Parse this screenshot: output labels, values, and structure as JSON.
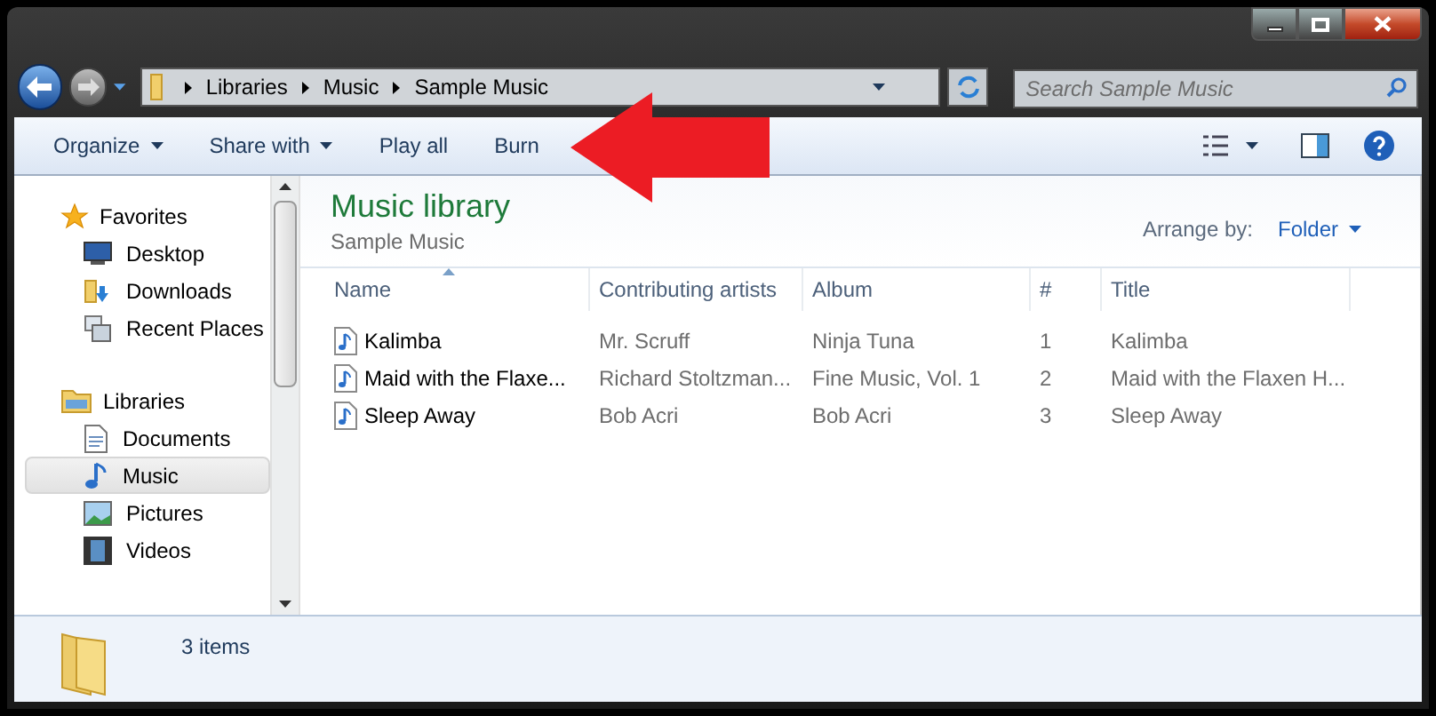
{
  "address": {
    "crumbs": [
      "Libraries",
      "Music",
      "Sample Music"
    ]
  },
  "search": {
    "placeholder": "Search Sample Music"
  },
  "toolbar": [
    {
      "label": "Organize",
      "menu": true
    },
    {
      "label": "Share with",
      "menu": true
    },
    {
      "label": "Play all",
      "menu": false
    },
    {
      "label": "Burn",
      "menu": false
    }
  ],
  "nav": [
    {
      "label": "Favorites",
      "children": [
        {
          "label": "Desktop",
          "selected": false
        },
        {
          "label": "Downloads",
          "selected": false
        },
        {
          "label": "Recent Places",
          "selected": false
        }
      ]
    },
    {
      "label": "Libraries",
      "children": [
        {
          "label": "Documents",
          "selected": false
        },
        {
          "label": "Music",
          "selected": true
        },
        {
          "label": "Pictures",
          "selected": false
        },
        {
          "label": "Videos",
          "selected": false
        }
      ]
    }
  ],
  "library": {
    "title": "Music library",
    "subtitle": "Sample Music",
    "arrange_label": "Arrange by:",
    "arrange_value": "Folder"
  },
  "table": {
    "columns": [
      "Name",
      "Contributing artists",
      "Album",
      "#",
      "Title"
    ],
    "rows": [
      [
        "Kalimba",
        "Mr. Scruff",
        "Ninja Tuna",
        "1",
        "Kalimba"
      ],
      [
        "Maid with the Flaxe...",
        "Richard Stoltzman...",
        "Fine Music, Vol. 1",
        "2",
        "Maid with the Flaxen H..."
      ],
      [
        "Sleep Away",
        "Bob Acri",
        "Bob Acri",
        "3",
        "Sleep Away"
      ]
    ]
  },
  "status_bar": {
    "text": "3 items"
  }
}
